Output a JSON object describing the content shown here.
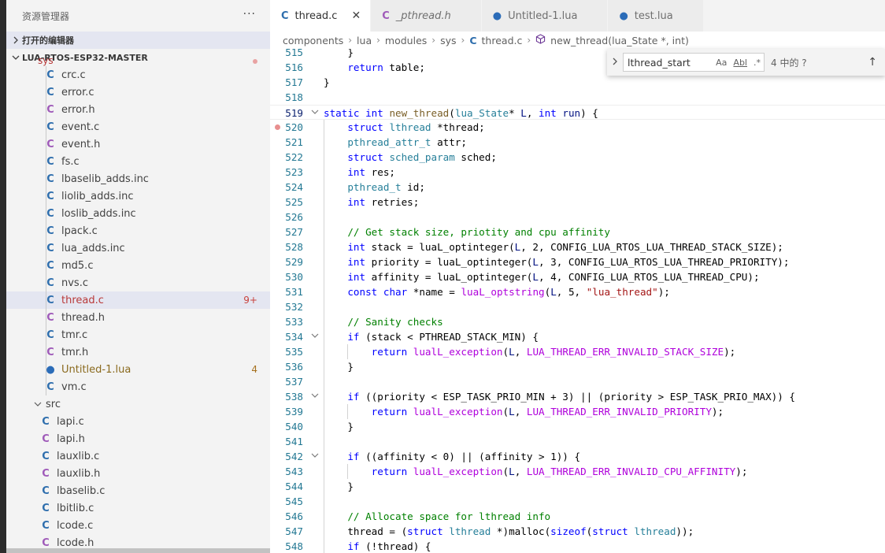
{
  "sidebar": {
    "title": "资源管理器",
    "more_label": "···",
    "open_editors": "打开的编辑器",
    "project": "LUA-RTOS-ESP32-MASTER",
    "truncated_folder": "sys",
    "files": [
      {
        "name": "crc.c",
        "type": "c"
      },
      {
        "name": "error.c",
        "type": "c"
      },
      {
        "name": "error.h",
        "type": "h"
      },
      {
        "name": "event.c",
        "type": "c"
      },
      {
        "name": "event.h",
        "type": "h"
      },
      {
        "name": "fs.c",
        "type": "c"
      },
      {
        "name": "lbaselib_adds.inc",
        "type": "c"
      },
      {
        "name": "liolib_adds.inc",
        "type": "c"
      },
      {
        "name": "loslib_adds.inc",
        "type": "c"
      },
      {
        "name": "lpack.c",
        "type": "c"
      },
      {
        "name": "lua_adds.inc",
        "type": "c"
      },
      {
        "name": "md5.c",
        "type": "c"
      },
      {
        "name": "nvs.c",
        "type": "c"
      },
      {
        "name": "thread.c",
        "type": "c",
        "badge": "9+"
      },
      {
        "name": "thread.h",
        "type": "h"
      },
      {
        "name": "tmr.c",
        "type": "c"
      },
      {
        "name": "tmr.h",
        "type": "h"
      },
      {
        "name": "Untitled-1.lua",
        "type": "lua",
        "badge": "4"
      },
      {
        "name": "vm.c",
        "type": "c"
      }
    ],
    "src_folder": "src",
    "src_files": [
      {
        "name": "lapi.c",
        "type": "c"
      },
      {
        "name": "lapi.h",
        "type": "h"
      },
      {
        "name": "lauxlib.c",
        "type": "c"
      },
      {
        "name": "lauxlib.h",
        "type": "h"
      },
      {
        "name": "lbaselib.c",
        "type": "c"
      },
      {
        "name": "lbitlib.c",
        "type": "c"
      },
      {
        "name": "lcode.c",
        "type": "c"
      },
      {
        "name": "lcode.h",
        "type": "h"
      }
    ]
  },
  "tabs": [
    {
      "label": "thread.c",
      "type": "c",
      "active": true
    },
    {
      "label": "_pthread.h",
      "type": "c",
      "italic": true
    },
    {
      "label": "Untitled-1.lua",
      "type": "lua"
    },
    {
      "label": "test.lua",
      "type": "lua"
    }
  ],
  "breadcrumb": {
    "parts": [
      "components",
      "lua",
      "modules",
      "sys"
    ],
    "file": "thread.c",
    "symbol": "new_thread(lua_State *, int)"
  },
  "find": {
    "value": "lthread_start",
    "opt_case": "Aa",
    "opt_word": "Abl",
    "opt_regex": ".*",
    "result": "4 中的 ?"
  },
  "icons": {
    "c": "C",
    "lua": "●",
    "chevron_right": "›",
    "chevron_down": "⌄",
    "close": "✕",
    "arrow_up": "↑",
    "cube": "⬡"
  },
  "editor": {
    "lines": [
      {
        "n": "515",
        "html": "    }"
      },
      {
        "n": "516",
        "html": "    <span class=\"kw\">return</span> table;"
      },
      {
        "n": "517",
        "html": "}"
      },
      {
        "n": "518",
        "html": ""
      },
      {
        "n": "519",
        "fold": true,
        "current": true,
        "html": "<span class=\"kw\">static</span> <span class=\"kw\">int</span> <span class=\"fn\">new_thread</span>(<span class=\"ty\">lua_State</span>* <span class=\"prm\">L</span>, <span class=\"kw\">int</span> <span class=\"prm\">run</span>) {"
      },
      {
        "n": "520",
        "bp": true,
        "html": "    <span class=\"kw\">struct</span> <span class=\"ty\">lthread</span> *thread;"
      },
      {
        "n": "521",
        "html": "    <span class=\"ty\">pthread_attr_t</span> attr;"
      },
      {
        "n": "522",
        "html": "    <span class=\"kw\">struct</span> <span class=\"ty\">sched_param</span> sched;"
      },
      {
        "n": "523",
        "html": "    <span class=\"kw\">int</span> res;"
      },
      {
        "n": "524",
        "html": "    <span class=\"ty\">pthread_t</span> id;"
      },
      {
        "n": "525",
        "html": "    <span class=\"kw\">int</span> retries;"
      },
      {
        "n": "526",
        "html": ""
      },
      {
        "n": "527",
        "html": "    <span class=\"cm\">// Get stack size, priotity and cpu affinity</span>"
      },
      {
        "n": "528",
        "html": "    <span class=\"kw\">int</span> stack = luaL_optinteger(<span class=\"prm\">L</span>, 2, CONFIG_LUA_RTOS_LUA_THREAD_STACK_SIZE);"
      },
      {
        "n": "529",
        "html": "    <span class=\"kw\">int</span> priority = luaL_optinteger(<span class=\"prm\">L</span>, 3, CONFIG_LUA_RTOS_LUA_THREAD_PRIORITY);"
      },
      {
        "n": "530",
        "html": "    <span class=\"kw\">int</span> affinity = luaL_optinteger(<span class=\"prm\">L</span>, 4, CONFIG_LUA_RTOS_LUA_THREAD_CPU);"
      },
      {
        "n": "531",
        "html": "    <span class=\"kw\">const</span> <span class=\"kw\">char</span> *name = <span class=\"lua\">luaL_optstring</span>(<span class=\"prm\">L</span>, 5, <span class=\"st\">\"lua_thread\"</span>);"
      },
      {
        "n": "532",
        "html": ""
      },
      {
        "n": "533",
        "html": "    <span class=\"cm\">// Sanity checks</span>"
      },
      {
        "n": "534",
        "fold": true,
        "html": "    <span class=\"kw\">if</span> (stack &lt; PTHREAD_STACK_MIN) {"
      },
      {
        "n": "535",
        "html": "        <span class=\"kw\">return</span> <span class=\"lua\">lualL_exception</span>(<span class=\"prm\">L</span>, <span class=\"lua\">LUA_THREAD_ERR_INVALID_STACK_SIZE</span>);"
      },
      {
        "n": "536",
        "html": "    }"
      },
      {
        "n": "537",
        "html": ""
      },
      {
        "n": "538",
        "fold": true,
        "html": "    <span class=\"kw\">if</span> ((priority &lt; ESP_TASK_PRIO_MIN + 3) || (priority &gt; ESP_TASK_PRIO_MAX)) {"
      },
      {
        "n": "539",
        "html": "        <span class=\"kw\">return</span> <span class=\"lua\">lualL_exception</span>(<span class=\"prm\">L</span>, <span class=\"lua\">LUA_THREAD_ERR_INVALID_PRIORITY</span>);"
      },
      {
        "n": "540",
        "html": "    }"
      },
      {
        "n": "541",
        "html": ""
      },
      {
        "n": "542",
        "fold": true,
        "html": "    <span class=\"kw\">if</span> ((affinity &lt; 0) || (affinity &gt; 1)) {"
      },
      {
        "n": "543",
        "html": "        <span class=\"kw\">return</span> <span class=\"lua\">lualL_exception</span>(<span class=\"prm\">L</span>, <span class=\"lua\">LUA_THREAD_ERR_INVALID_CPU_AFFINITY</span>);"
      },
      {
        "n": "544",
        "html": "    }"
      },
      {
        "n": "545",
        "html": ""
      },
      {
        "n": "546",
        "html": "    <span class=\"cm\">// Allocate space for lthread info</span>"
      },
      {
        "n": "547",
        "html": "    thread = (<span class=\"kw\">struct</span> <span class=\"ty\">lthread</span> *)malloc(<span class=\"kw\">sizeof</span>(<span class=\"kw\">struct</span> <span class=\"ty\">lthread</span>));"
      },
      {
        "n": "548",
        "html": "    <span class=\"kw\">if</span> (!thread) {"
      }
    ]
  }
}
